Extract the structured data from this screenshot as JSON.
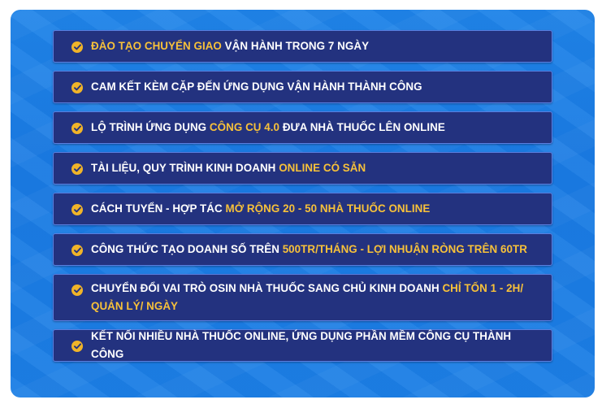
{
  "accent_colors": {
    "panel_bg": "#1f84e8",
    "item_bg": "#23327f",
    "item_border": "#5a7fe0",
    "highlight_text": "#f7c13a",
    "check_icon": "#f0b429"
  },
  "items": [
    {
      "parts": [
        {
          "text": "ĐÀO TẠO CHUYỂN GIAO",
          "hl": true
        },
        {
          "text": " VẬN HÀNH TRONG 7 NGÀY",
          "hl": false
        }
      ]
    },
    {
      "parts": [
        {
          "text": "CAM KẾT KÈM CẶP ĐẾN ỨNG DỤNG VẬN HÀNH THÀNH CÔNG",
          "hl": false
        }
      ]
    },
    {
      "parts": [
        {
          "text": "LỘ TRÌNH ỨNG DỤNG ",
          "hl": false
        },
        {
          "text": "CÔNG CỤ 4.0",
          "hl": true
        },
        {
          "text": " ĐƯA NHÀ THUỐC LÊN ONLINE",
          "hl": false
        }
      ]
    },
    {
      "parts": [
        {
          "text": "TÀI LIỆU, QUY TRÌNH KINH DOANH ",
          "hl": false
        },
        {
          "text": "ONLINE CÓ SẴN",
          "hl": true
        }
      ]
    },
    {
      "parts": [
        {
          "text": "CÁCH TUYỂN - HỢP TÁC ",
          "hl": false
        },
        {
          "text": "MỞ RỘNG 20 - 50 NHÀ THUỐC ONLINE",
          "hl": true
        }
      ]
    },
    {
      "parts": [
        {
          "text": "CÔNG THỨC TẠO DOANH SỐ TRÊN ",
          "hl": false
        },
        {
          "text": "500TR/THÁNG - LỢI NHUẬN RÒNG TRÊN 60TR",
          "hl": true
        }
      ]
    },
    {
      "parts": [
        {
          "text": "CHUYỂN ĐỔI VAI TRÒ OSIN NHÀ THUỐC SANG CHỦ KINH DOANH ",
          "hl": false
        },
        {
          "text": "CHỈ TỐN 1 - 2H/ QUẢN LÝ/ NGÀY",
          "hl": true
        }
      ]
    },
    {
      "parts": [
        {
          "text": "KẾT NỐI NHIỀU NHÀ THUỐC ONLINE, ỨNG DỤNG PHẦN MỀM CÔNG CỤ THÀNH CÔNG",
          "hl": false
        }
      ]
    }
  ]
}
